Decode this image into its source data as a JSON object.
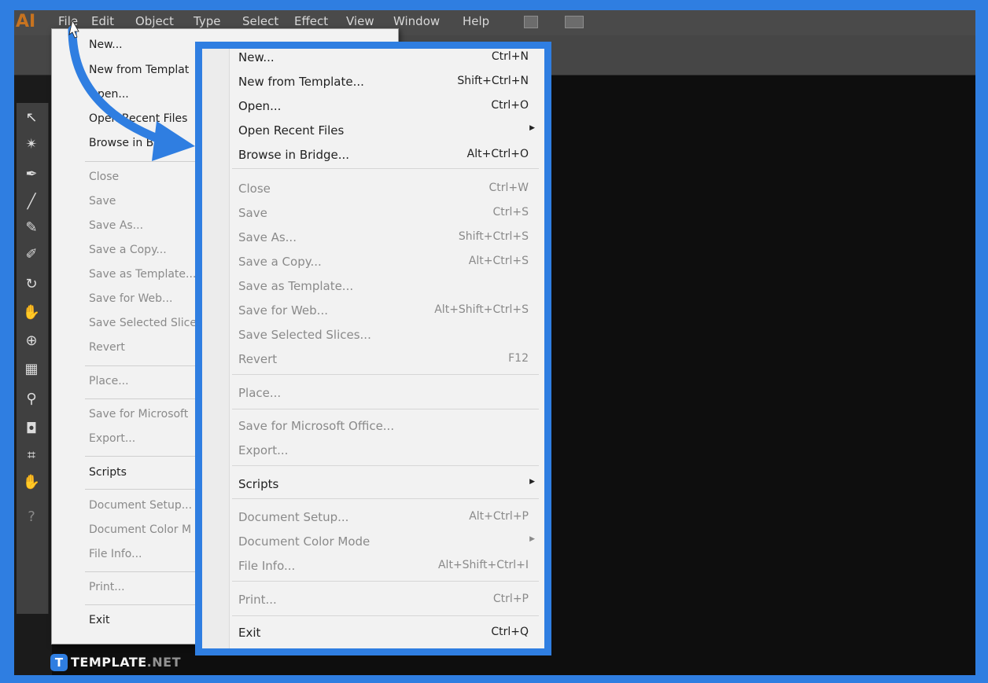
{
  "app": {
    "logo": "AI"
  },
  "menubar": {
    "items": [
      "File",
      "Edit",
      "Object",
      "Type",
      "Select",
      "Effect",
      "View",
      "Window",
      "Help"
    ]
  },
  "bg_menu": {
    "items": [
      {
        "label": "New...",
        "enabled": true
      },
      {
        "label": "New from Templat",
        "enabled": true
      },
      {
        "label": "Open...",
        "enabled": true
      },
      {
        "label": "Open Recent Files",
        "enabled": true
      },
      {
        "label": "Browse in Bridge...",
        "enabled": true
      },
      {
        "label": "Close",
        "enabled": false
      },
      {
        "label": "Save",
        "enabled": false
      },
      {
        "label": "Save As...",
        "enabled": false
      },
      {
        "label": "Save a Copy...",
        "enabled": false
      },
      {
        "label": "Save as Template...",
        "enabled": false
      },
      {
        "label": "Save for Web...",
        "enabled": false
      },
      {
        "label": "Save Selected Slice",
        "enabled": false
      },
      {
        "label": "Revert",
        "enabled": false
      },
      {
        "label": "Place...",
        "enabled": false
      },
      {
        "label": "Save for Microsoft",
        "enabled": false
      },
      {
        "label": "Export...",
        "enabled": false
      },
      {
        "label": "Scripts",
        "enabled": true
      },
      {
        "label": "Document Setup...",
        "enabled": false
      },
      {
        "label": "Document Color M",
        "enabled": false
      },
      {
        "label": "File Info...",
        "enabled": false
      },
      {
        "label": "Print...",
        "enabled": false
      },
      {
        "label": "Exit",
        "enabled": true
      }
    ]
  },
  "file_menu": {
    "items": [
      {
        "label": "New...",
        "shortcut": "Ctrl+N",
        "enabled": true,
        "submenu": false
      },
      {
        "label": "New from Template...",
        "shortcut": "Shift+Ctrl+N",
        "enabled": true,
        "submenu": false
      },
      {
        "label": "Open...",
        "shortcut": "Ctrl+O",
        "enabled": true,
        "submenu": false
      },
      {
        "label": "Open Recent Files",
        "shortcut": "",
        "enabled": true,
        "submenu": true
      },
      {
        "label": "Browse in Bridge...",
        "shortcut": "Alt+Ctrl+O",
        "enabled": true,
        "submenu": false
      },
      {
        "label": "Close",
        "shortcut": "Ctrl+W",
        "enabled": false,
        "submenu": false
      },
      {
        "label": "Save",
        "shortcut": "Ctrl+S",
        "enabled": false,
        "submenu": false
      },
      {
        "label": "Save As...",
        "shortcut": "Shift+Ctrl+S",
        "enabled": false,
        "submenu": false
      },
      {
        "label": "Save a Copy...",
        "shortcut": "Alt+Ctrl+S",
        "enabled": false,
        "submenu": false
      },
      {
        "label": "Save as Template...",
        "shortcut": "",
        "enabled": false,
        "submenu": false
      },
      {
        "label": "Save for Web...",
        "shortcut": "Alt+Shift+Ctrl+S",
        "enabled": false,
        "submenu": false
      },
      {
        "label": "Save Selected Slices...",
        "shortcut": "",
        "enabled": false,
        "submenu": false
      },
      {
        "label": "Revert",
        "shortcut": "F12",
        "enabled": false,
        "submenu": false
      },
      {
        "label": "Place...",
        "shortcut": "",
        "enabled": false,
        "submenu": false
      },
      {
        "label": "Save for Microsoft Office...",
        "shortcut": "",
        "enabled": false,
        "submenu": false
      },
      {
        "label": "Export...",
        "shortcut": "",
        "enabled": false,
        "submenu": false
      },
      {
        "label": "Scripts",
        "shortcut": "",
        "enabled": true,
        "submenu": true
      },
      {
        "label": "Document Setup...",
        "shortcut": "Alt+Ctrl+P",
        "enabled": false,
        "submenu": false
      },
      {
        "label": "Document Color Mode",
        "shortcut": "",
        "enabled": false,
        "submenu": true
      },
      {
        "label": "File Info...",
        "shortcut": "Alt+Shift+Ctrl+I",
        "enabled": false,
        "submenu": false
      },
      {
        "label": "Print...",
        "shortcut": "Ctrl+P",
        "enabled": false,
        "submenu": false
      },
      {
        "label": "Exit",
        "shortcut": "Ctrl+Q",
        "enabled": true,
        "submenu": false
      }
    ]
  },
  "tools": [
    "selection-tool",
    "magic-wand-tool",
    "pen-tool",
    "line-tool",
    "brush-tool",
    "blob-brush-tool",
    "rotate-tool",
    "warp-tool",
    "shape-builder-tool",
    "graph-tool",
    "eyedropper-tool",
    "symbol-sprayer-tool",
    "artboard-tool",
    "hand-tool",
    "help-icon"
  ],
  "watermark": {
    "badge": "T",
    "text": "TEMPLATE",
    "text2": ".NET"
  },
  "colors": {
    "highlight": "#2f7ee1",
    "menu_bg": "#f2f2f2",
    "canvas": "#0e0e0e"
  }
}
